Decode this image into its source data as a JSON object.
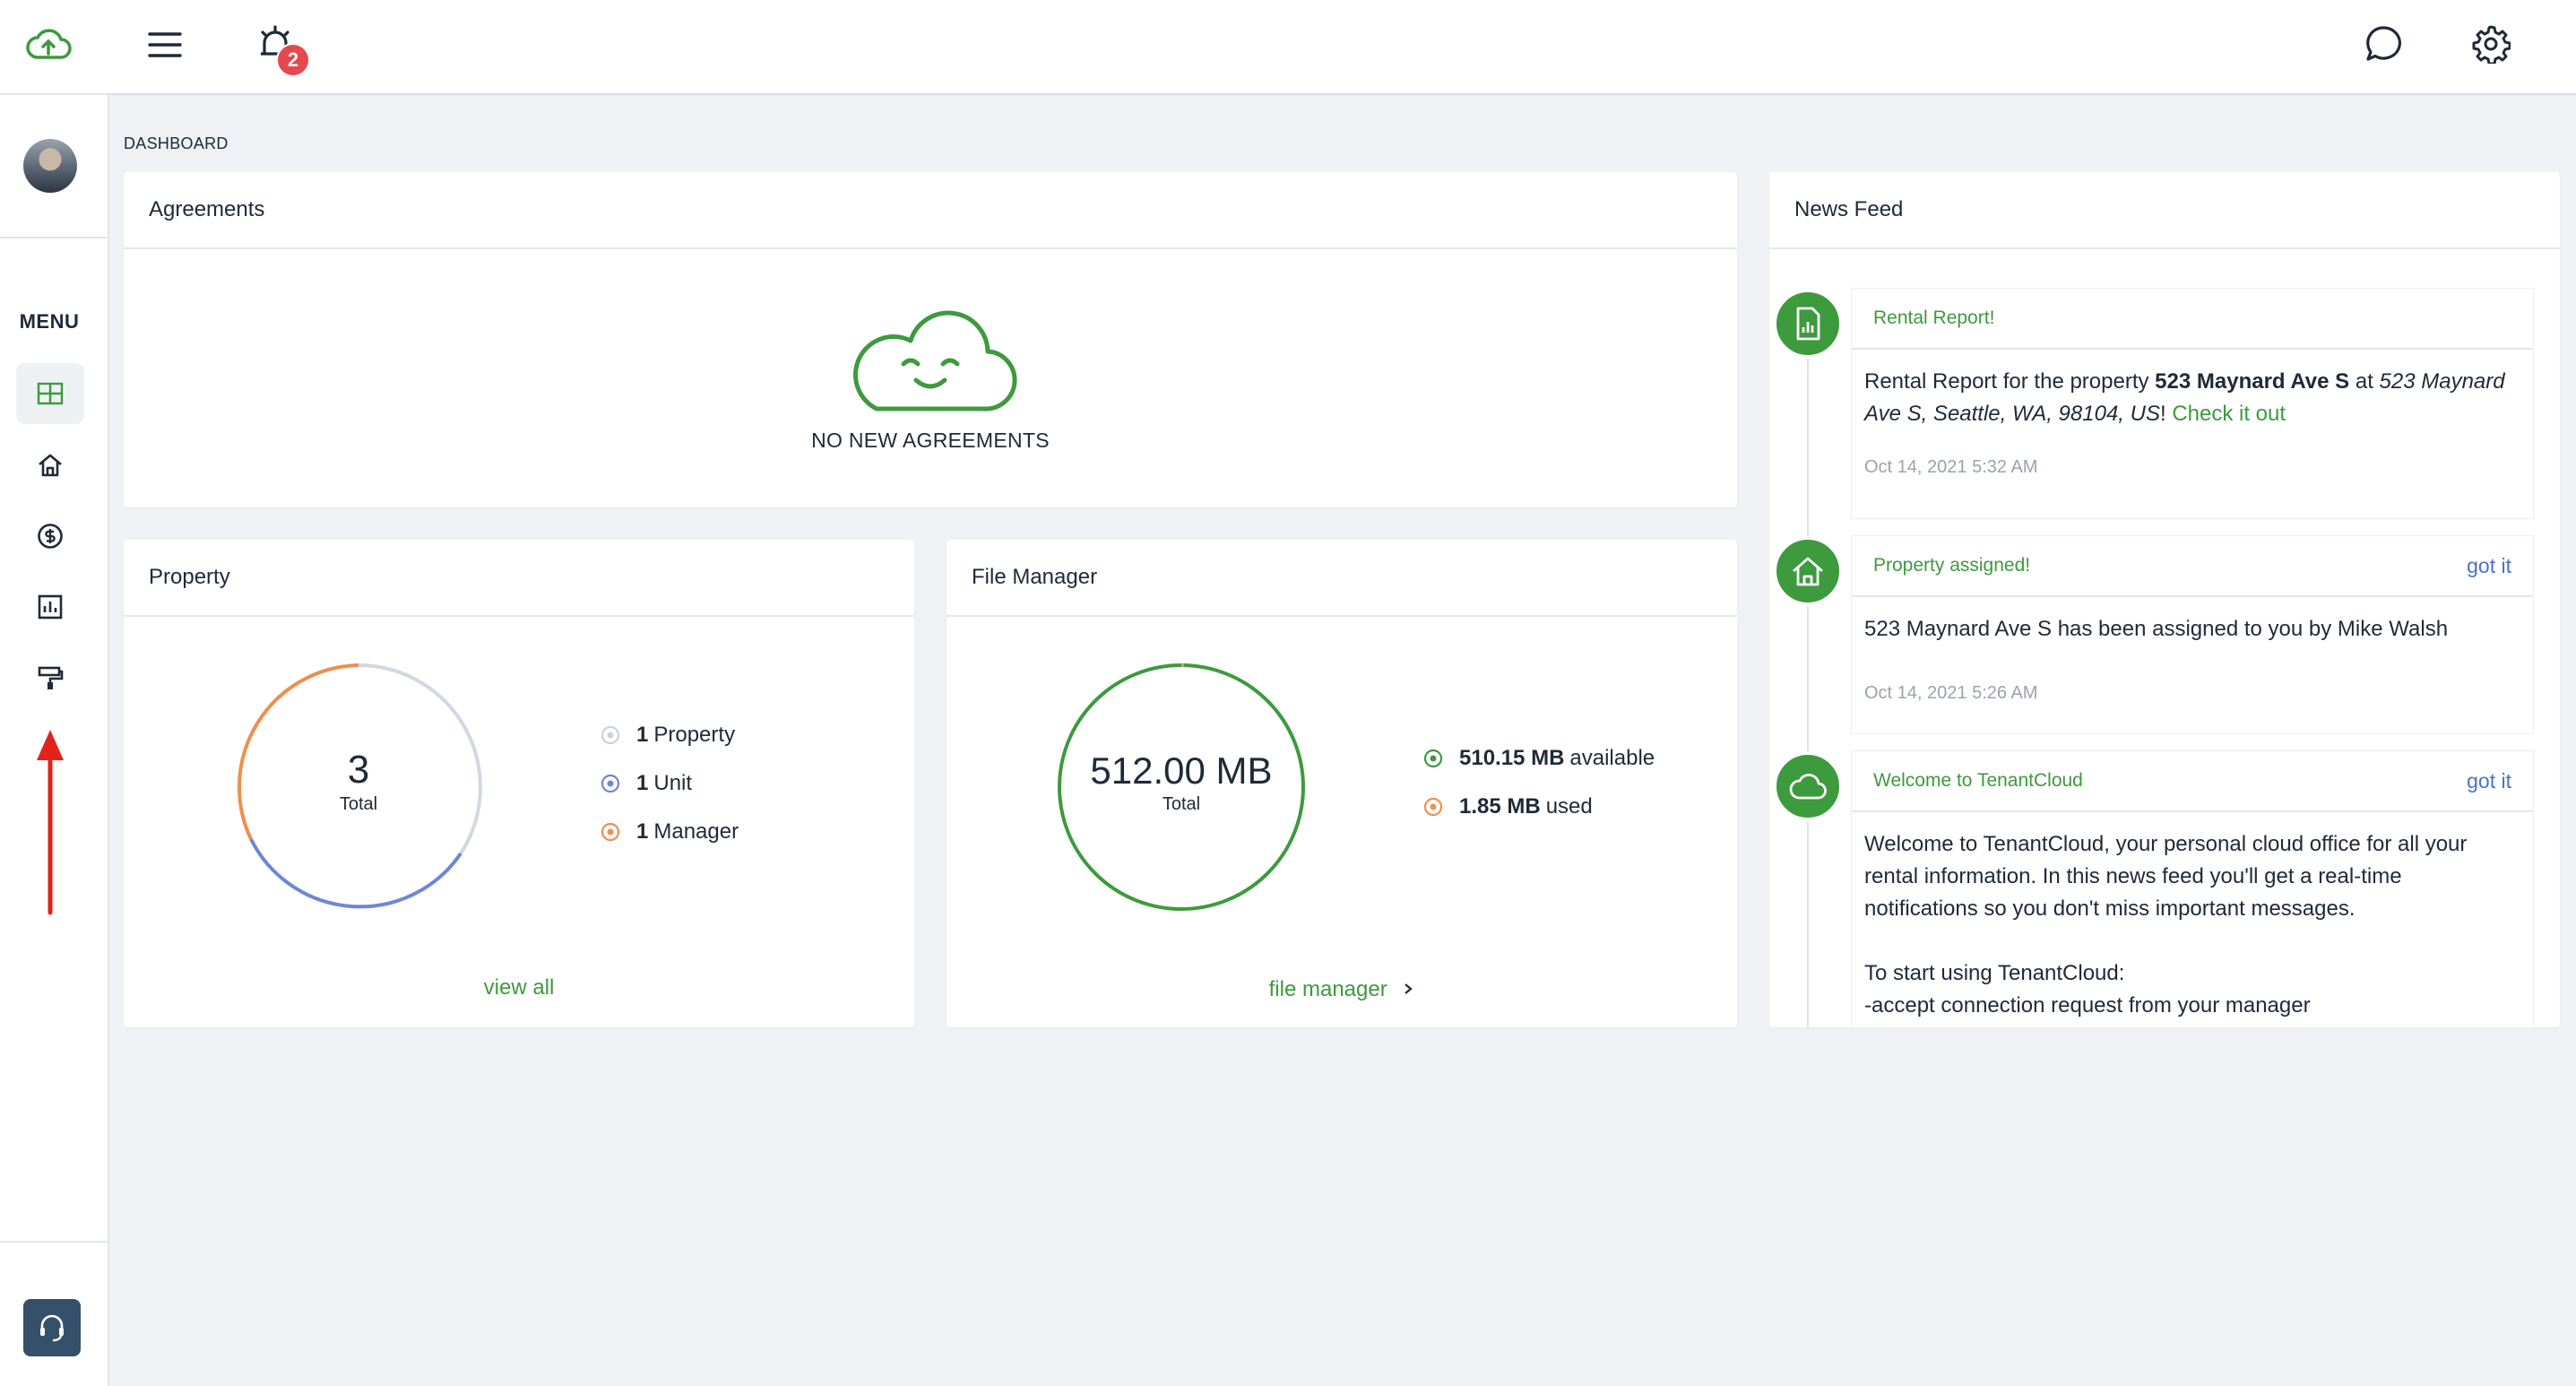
{
  "topbar": {
    "notification_count": "2"
  },
  "sidebar": {
    "menu_label": "MENU",
    "items": [
      {
        "icon": "dashboard-icon"
      },
      {
        "icon": "home-icon"
      },
      {
        "icon": "dollar-icon"
      },
      {
        "icon": "reports-icon"
      },
      {
        "icon": "maintenance-icon"
      }
    ]
  },
  "breadcrumb": "DASHBOARD",
  "agreements": {
    "title": "Agreements",
    "empty_text": "NO NEW AGREEMENTS"
  },
  "property": {
    "title": "Property",
    "total_value": "3",
    "total_label": "Total",
    "legend": [
      {
        "count": "1",
        "label": "Property",
        "color": "#c9d2de"
      },
      {
        "count": "1",
        "label": "Unit",
        "color": "#6f86d6"
      },
      {
        "count": "1",
        "label": "Manager",
        "color": "#ef8e4d"
      }
    ],
    "view_all": "view all"
  },
  "file_manager": {
    "title": "File Manager",
    "total_value": "512.00 MB",
    "total_label": "Total",
    "legend": [
      {
        "amount": "510.15 MB",
        "label": "available",
        "color": "#3d9a3d"
      },
      {
        "amount": "1.85 MB",
        "label": "used",
        "color": "#ef8e4d"
      }
    ],
    "link": "file manager"
  },
  "news_feed": {
    "title": "News Feed",
    "items": [
      {
        "title": "Rental Report!",
        "body_prefix": "Rental Report for the property ",
        "body_bold": "523 Maynard Ave S",
        "body_mid": " at ",
        "body_italic": "523 Maynard Ave S, Seattle, WA, 98104, US",
        "body_suffix": "! ",
        "link": "Check it out",
        "time": "Oct 14, 2021 5:32 AM"
      },
      {
        "title": "Property assigned!",
        "got_it": "got it",
        "body": "523 Maynard Ave S has been assigned to you by Mike Walsh",
        "time": "Oct 14, 2021 5:26 AM"
      },
      {
        "title": "Welcome to TenantCloud",
        "got_it": "got it",
        "body1": "Welcome to TenantCloud, your personal cloud office for all your rental information. In this news feed you'll get a real-time notifications so you don't miss important messages.",
        "body2": "To start using TenantCloud:",
        "body3": "-accept connection request from your manager"
      }
    ]
  },
  "colors": {
    "brand_green": "#3d9a3d",
    "accent_blue": "#6f86d6",
    "accent_orange": "#ef8e4d",
    "annotation_red": "#e2231a"
  }
}
